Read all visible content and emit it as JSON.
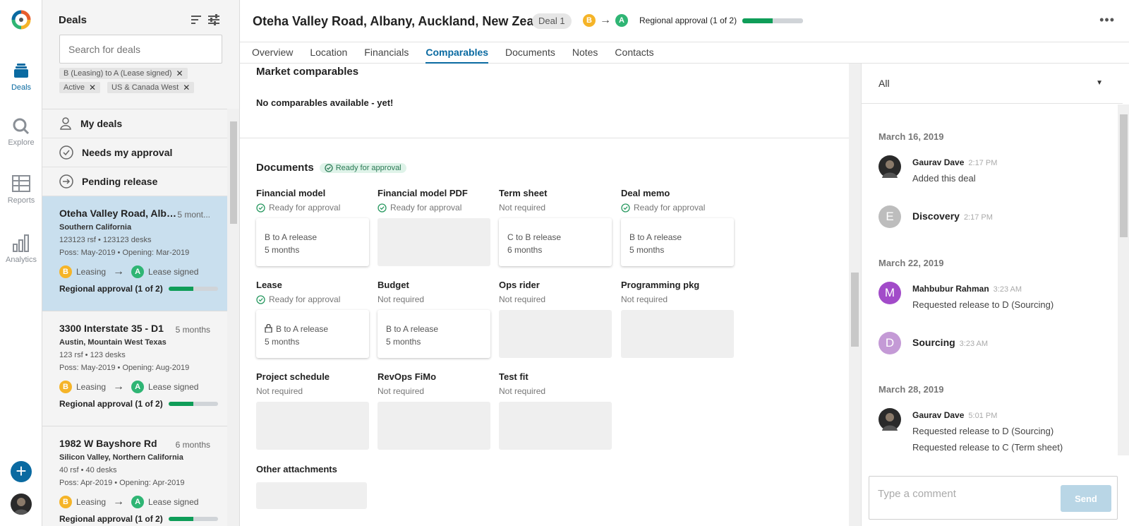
{
  "rail": {
    "items": [
      {
        "label": "Deals",
        "icon": "deals-icon"
      },
      {
        "label": "Explore",
        "icon": "explore-icon"
      },
      {
        "label": "Reports",
        "icon": "reports-icon"
      },
      {
        "label": "Analytics",
        "icon": "analytics-icon"
      }
    ],
    "accent": "#0a6aa1"
  },
  "deals": {
    "heading": "Deals",
    "search_placeholder": "Search for deals",
    "chips": [
      "B (Leasing) to A (Lease signed)",
      "Active",
      "US & Canada West"
    ],
    "filters": [
      "My deals",
      "Needs my approval",
      "Pending release"
    ],
    "cards": [
      {
        "title": "Oteha Valley Road, Alba...",
        "age": "5 mont...",
        "region": "Southern California",
        "size": "123123 rsf • 123123 desks",
        "dates": "Poss: May-2019 • Opening: Mar-2019",
        "from_badge": "B",
        "from": "Leasing",
        "to_badge": "A",
        "to": "Lease signed",
        "approval": "Regional approval (1 of 2)",
        "progress": 0.5
      },
      {
        "title": "3300 Interstate 35 - D1",
        "age": "5 months",
        "region": "Austin, Mountain West Texas",
        "size": "123 rsf • 123 desks",
        "dates": "Poss: May-2019 • Opening: Aug-2019",
        "from_badge": "B",
        "from": "Leasing",
        "to_badge": "A",
        "to": "Lease signed",
        "approval": "Regional approval (1 of 2)",
        "progress": 0.5
      },
      {
        "title": "1982 W Bayshore Rd",
        "age": "6 months",
        "region": "Silicon Valley, Northern California",
        "size": "40 rsf • 40 desks",
        "dates": "Poss: Apr-2019 • Opening: Apr-2019",
        "from_badge": "B",
        "from": "Leasing",
        "to_badge": "A",
        "to": "Lease signed",
        "approval": "Regional approval (1 of 2)",
        "progress": 0.5
      }
    ]
  },
  "header": {
    "title": "Oteha Valley Road, Albany, Auckland, New Zeal",
    "deal_pill": "Deal 1",
    "from_badge": "B",
    "to_badge": "A",
    "approval": "Regional approval (1 of 2)",
    "progress": 0.5,
    "more": "•••"
  },
  "tabs": [
    "Overview",
    "Location",
    "Financials",
    "Comparables",
    "Documents",
    "Notes",
    "Contacts"
  ],
  "active_tab": "Comparables",
  "market": {
    "title": "Market comparables",
    "empty": "No comparables available - yet!"
  },
  "documents": {
    "title": "Documents",
    "tag": "Ready for approval",
    "items": [
      {
        "name": "Financial model",
        "status": "Ready for approval",
        "ready": true,
        "box": [
          "B to A release",
          "5 months"
        ]
      },
      {
        "name": "Financial model PDF",
        "status": "Ready for approval",
        "ready": true,
        "box": []
      },
      {
        "name": "Term sheet",
        "status": "Not required",
        "ready": false,
        "box": [
          "C to B release",
          "6 months"
        ]
      },
      {
        "name": "Deal memo",
        "status": "Ready for approval",
        "ready": true,
        "box": [
          "B to A release",
          "5 months"
        ]
      },
      {
        "name": "Lease",
        "status": "Ready for approval",
        "ready": true,
        "box": [
          "B to A release",
          "5 months"
        ],
        "locked": true
      },
      {
        "name": "Budget",
        "status": "Not required",
        "ready": false,
        "box": [
          "B to A release",
          "5 months"
        ]
      },
      {
        "name": "Ops rider",
        "status": "Not required",
        "ready": false,
        "box": []
      },
      {
        "name": "Programming pkg",
        "status": "Not required",
        "ready": false,
        "box": []
      },
      {
        "name": "Project schedule",
        "status": "Not required",
        "ready": false,
        "box": []
      },
      {
        "name": "RevOps FiMo",
        "status": "Not required",
        "ready": false,
        "box": []
      },
      {
        "name": "Test fit",
        "status": "Not required",
        "ready": false,
        "box": []
      }
    ],
    "other_title": "Other attachments"
  },
  "activity": {
    "filter": "All",
    "groups": [
      {
        "date": "March 16, 2019",
        "entries": [
          {
            "who": "Gaurav Dave",
            "when": "2:17 PM",
            "what": [
              "Added this deal"
            ],
            "avatar": "photo"
          },
          {
            "who": "Discovery",
            "when": "2:17 PM",
            "what": [],
            "avatar": "E",
            "avatar_color": "#bdbdbd"
          }
        ]
      },
      {
        "date": "March 22, 2019",
        "entries": [
          {
            "who": "Mahbubur Rahman",
            "when": "3:23 AM",
            "what": [
              "Requested release to D (Sourcing)"
            ],
            "avatar": "M",
            "avatar_color": "#a24bc9"
          },
          {
            "who": "Sourcing",
            "when": "3:23 AM",
            "what": [],
            "avatar": "D",
            "avatar_color": "#c49ad6"
          }
        ]
      },
      {
        "date": "March 28, 2019",
        "entries": [
          {
            "who": "Gaurav Dave",
            "when": "5:01 PM",
            "what": [
              "Requested release to D (Sourcing)",
              "Requested release to C (Term sheet)"
            ],
            "avatar": "photo"
          }
        ]
      }
    ],
    "comment_placeholder": "Type a comment",
    "send_label": "Send"
  },
  "colors": {
    "badge_b": "#f5b428",
    "badge_a": "#2fb574",
    "progress": "#0f9d58",
    "selected_card": "#c9dfee"
  }
}
